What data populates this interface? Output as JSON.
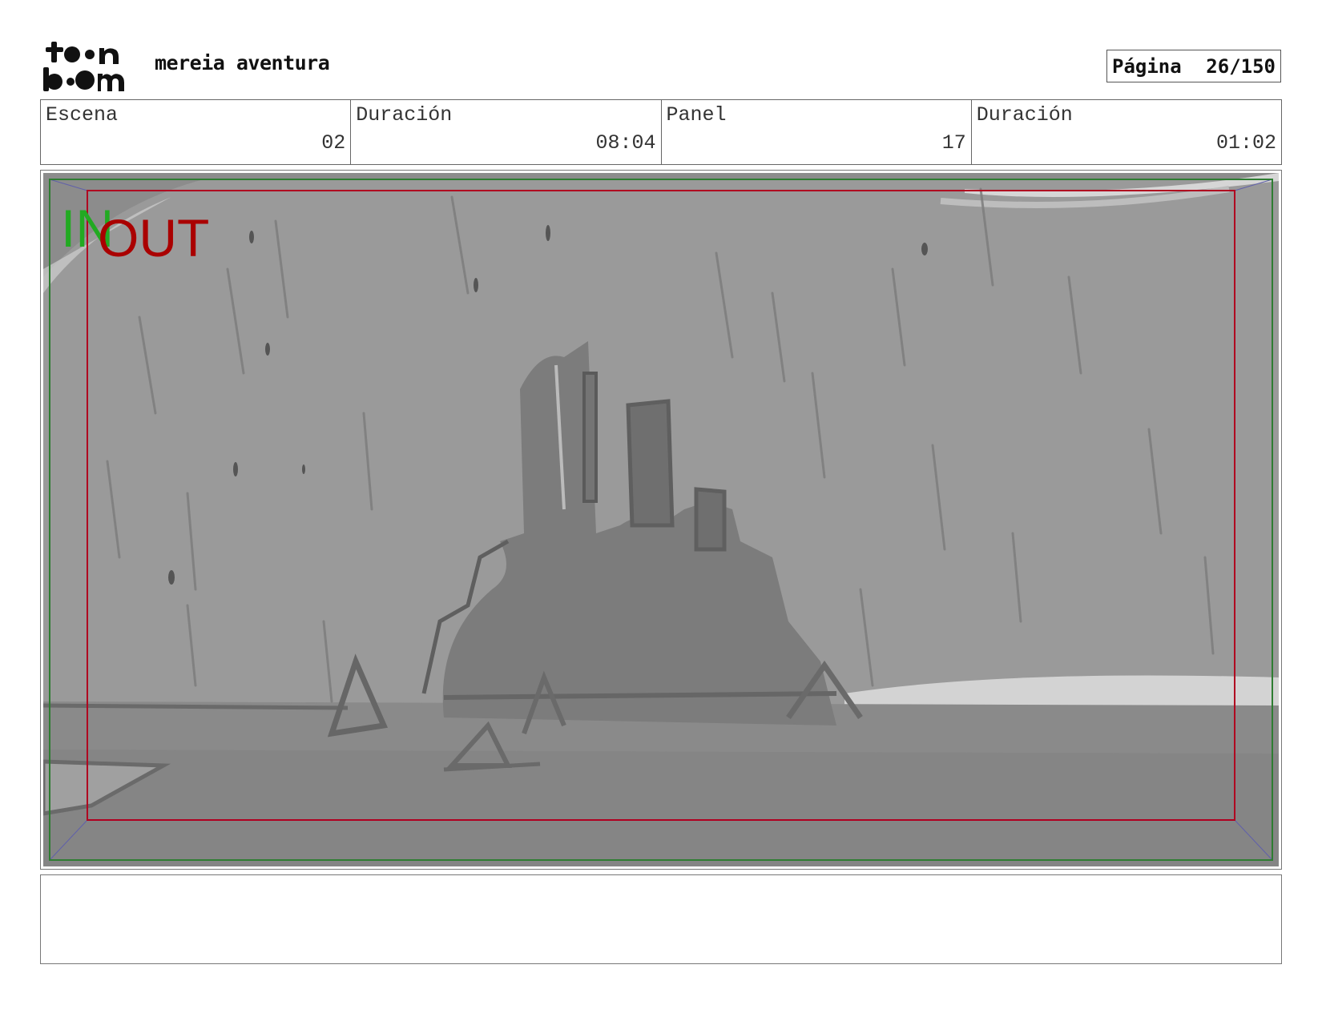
{
  "header": {
    "logo_text": "toon boom",
    "project_title": "mereia aventura",
    "page_label": "Página",
    "page_number": "26/150"
  },
  "info": {
    "scene_label": "Escena",
    "scene_value": "02",
    "scene_duration_label": "Duración",
    "scene_duration_value": "08:04",
    "panel_label": "Panel",
    "panel_value": "17",
    "panel_duration_label": "Duración",
    "panel_duration_value": "01:02"
  },
  "panel": {
    "in_marker": "IN",
    "out_marker": "OUT",
    "colors": {
      "in_frame": "#2e7d32",
      "out_frame": "#b00020",
      "in_text": "#22aa22",
      "out_text": "#aa0000"
    }
  },
  "dialogue": {
    "text": ""
  }
}
